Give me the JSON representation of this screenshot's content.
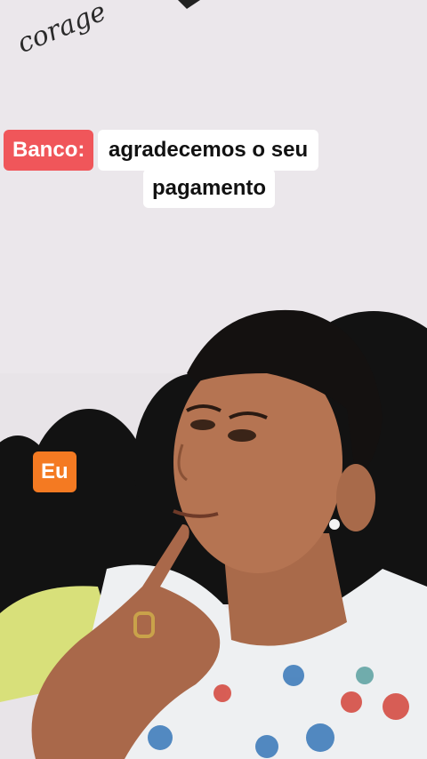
{
  "wall_text": "corage",
  "caption": {
    "speaker": "Banco:",
    "line1": "agradecemos o seu",
    "line2": "pagamento"
  },
  "tag": {
    "label": "Eu"
  },
  "colors": {
    "speaker_bg": "#f0565a",
    "tag_bg": "#f47a22",
    "caption_bg": "#ffffff"
  }
}
